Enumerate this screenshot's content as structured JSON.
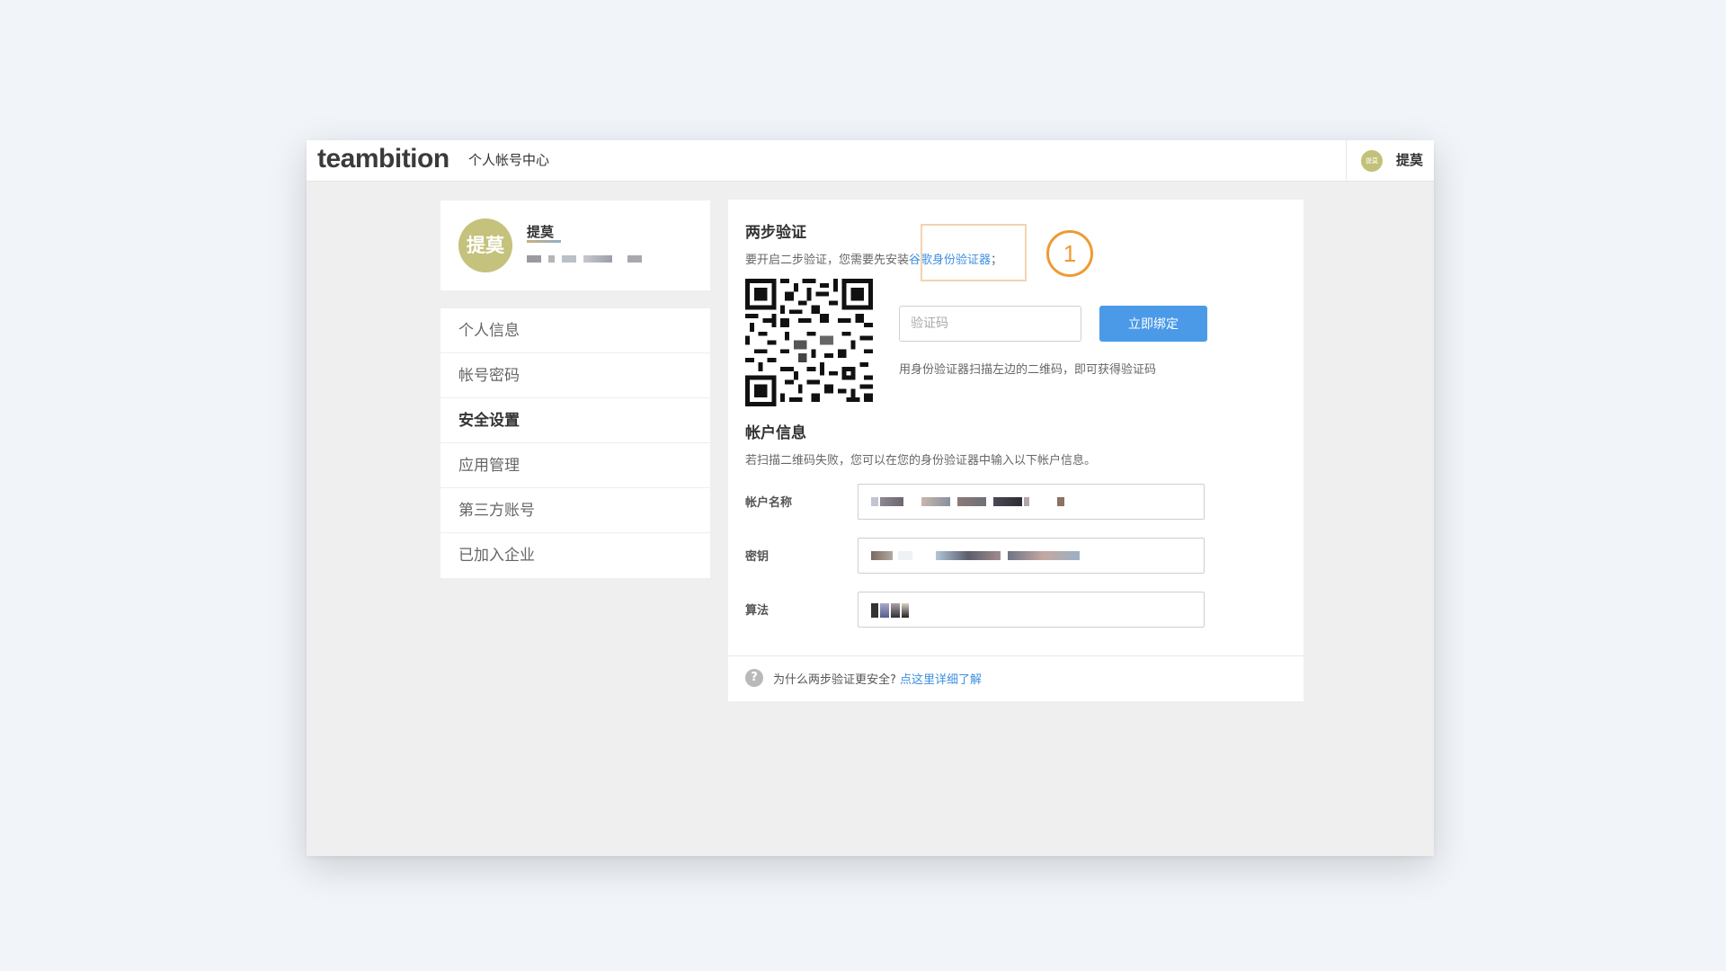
{
  "app": {
    "logo": "teambition",
    "page_title": "个人帐号中心"
  },
  "user": {
    "avatar_text": "提莫",
    "name": "提莫"
  },
  "sidebar": {
    "items": [
      {
        "label": "个人信息"
      },
      {
        "label": "帐号密码"
      },
      {
        "label": "安全设置",
        "active": true
      },
      {
        "label": "应用管理"
      },
      {
        "label": "第三方账号"
      },
      {
        "label": "已加入企业"
      }
    ]
  },
  "two_step": {
    "title": "两步验证",
    "desc_prefix": "要开启二步验证，您需要先安装",
    "app_link": "谷歌身份验证器",
    "desc_suffix": "；",
    "step_marker": "1",
    "code_placeholder": "验证码",
    "bind_label": "立即绑定",
    "scan_hint": "用身份验证器扫描左边的二维码，即可获得验证码"
  },
  "account_info": {
    "title": "帐户信息",
    "desc": "若扫描二维码失败，您可以在您的身份验证器中输入以下帐户信息。",
    "fields": [
      {
        "label": "帐户名称"
      },
      {
        "label": "密钥"
      },
      {
        "label": "算法"
      }
    ]
  },
  "footer": {
    "help_icon": "?",
    "question": "为什么两步验证更安全?",
    "learn_more": "点这里详细了解"
  },
  "colors": {
    "accent": "#4a9ae8",
    "link": "#3d8fe0",
    "step_marker": "#ee9b33",
    "avatar": "#c4c27c"
  }
}
